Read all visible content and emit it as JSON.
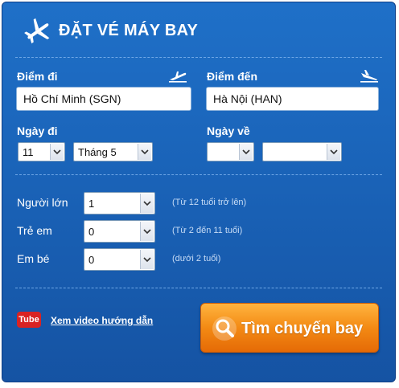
{
  "header": {
    "title": "ĐẶT VÉ MÁY BAY"
  },
  "route": {
    "from_label": "Điểm đi",
    "from_value": "Hồ Chí Minh (SGN)",
    "to_label": "Điểm đến",
    "to_value": "Hà Nội (HAN)"
  },
  "dates": {
    "depart_label": "Ngày đi",
    "depart_day": "11",
    "depart_month": "Tháng 5",
    "return_label": "Ngày về",
    "return_day": "",
    "return_month": ""
  },
  "passengers": [
    {
      "label": "Người lớn",
      "value": "1",
      "note": "(Từ 12 tuổi trở lên)"
    },
    {
      "label": "Trẻ em",
      "value": "0",
      "note": "(Từ 2 đến 11 tuổi)"
    },
    {
      "label": "Em bé",
      "value": "0",
      "note": "(dưới 2 tuổi)"
    }
  ],
  "video": {
    "badge": "Tube",
    "link": "Xem video hướng dẫn"
  },
  "search": {
    "label": "Tìm chuyến bay"
  },
  "colors": {
    "panel": "#1a63b8",
    "button": "#f38a14",
    "youtube": "#d92323"
  }
}
